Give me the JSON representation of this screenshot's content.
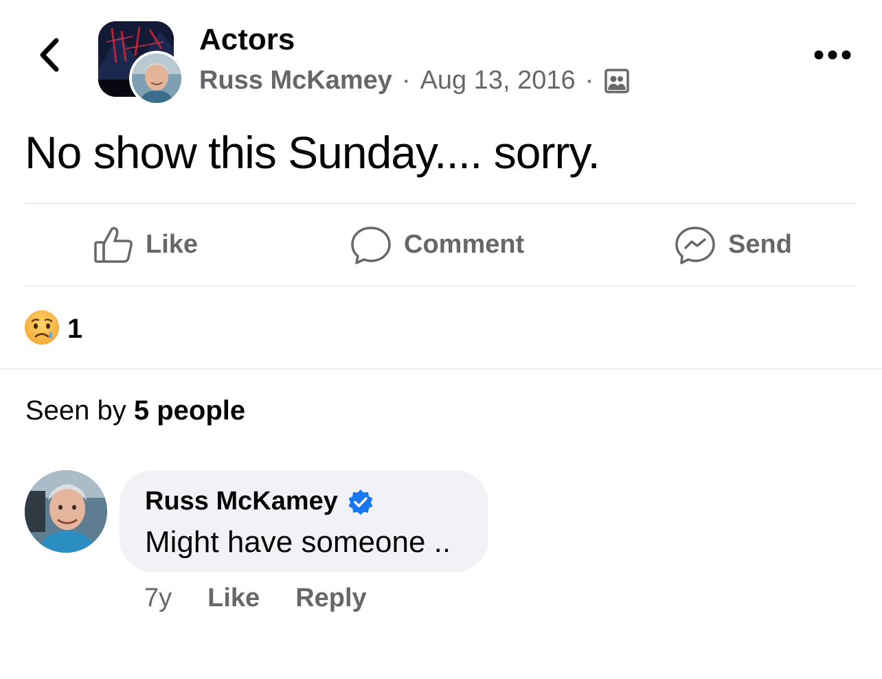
{
  "header": {
    "back_icon": "chevron-left-icon",
    "group_name": "Actors",
    "author": "Russ McKamey",
    "separator": "·",
    "date": "Aug 13, 2016",
    "audience_icon": "group-members-icon",
    "more_icon": "more-horizontal-icon"
  },
  "post": {
    "text": "No show this Sunday.... sorry."
  },
  "actions": [
    {
      "label": "Like",
      "icon": "thumbs-up-icon"
    },
    {
      "label": "Comment",
      "icon": "comment-bubble-icon"
    },
    {
      "label": "Send",
      "icon": "messenger-icon"
    }
  ],
  "reactions": {
    "emoji": "sad-tear-icon",
    "count": "1"
  },
  "seen_by": {
    "prefix": "Seen by",
    "count_text": "5 people"
  },
  "comment": {
    "author": "Russ McKamey",
    "verified_icon": "verified-badge-icon",
    "text": "Might have someone ..",
    "time": "7y",
    "like_label": "Like",
    "reply_label": "Reply"
  },
  "colors": {
    "text_primary": "#050505",
    "text_secondary": "#65676b",
    "bubble_bg": "#f0f2f5",
    "divider": "#dcdde0",
    "verified_blue": "#1877f2"
  }
}
